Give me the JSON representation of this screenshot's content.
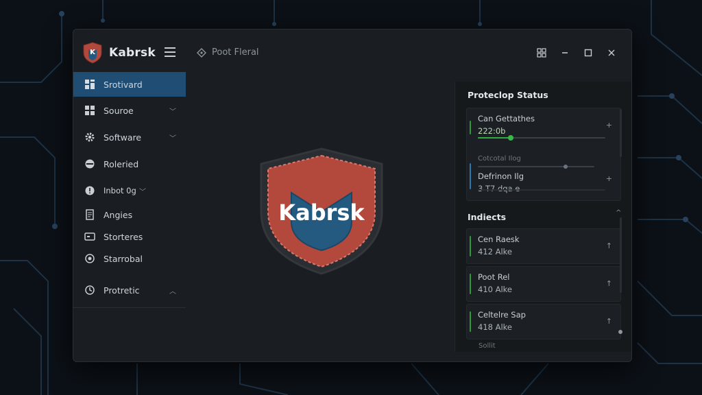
{
  "app": {
    "name": "Kabrsk",
    "breadcrumb": "Poot Fleral"
  },
  "colors": {
    "accent": "#1f4d73",
    "shield_red": "#b3483d",
    "shield_blue": "#245a80",
    "status_green": "#2fae3f",
    "status_blue": "#2e78b0"
  },
  "sidebar": {
    "items": [
      {
        "label": "Srotivard",
        "icon": "dashboard-icon",
        "active": true
      },
      {
        "label": "Souroe",
        "icon": "grid-icon",
        "chevron": "﹀"
      },
      {
        "label": "Software",
        "icon": "gear-icon",
        "chevron": "﹀"
      },
      {
        "label": "Roleried",
        "icon": "shield-icon"
      },
      {
        "label": "Inbot 0g",
        "icon": "info-icon",
        "chevron": "﹀"
      },
      {
        "label": "Angies",
        "icon": "document-icon"
      },
      {
        "label": "Storteres",
        "icon": "monitor-icon"
      },
      {
        "label": "Starrobal",
        "icon": "target-icon"
      },
      {
        "label": "Protretic",
        "icon": "clock-icon",
        "chevron": "︿"
      }
    ]
  },
  "center": {
    "logo_text": "Kabrsk"
  },
  "protection": {
    "title": "Proteclop Status",
    "cards": [
      {
        "title": "Can Gettathes",
        "value": "222:0b",
        "level": 0.26
      },
      {
        "title": "Defrinon Ilg",
        "value": "3 T7 dqa e",
        "header": "Cotcotal Ilog",
        "level": 0.75
      }
    ]
  },
  "incidents": {
    "title": "Indiects",
    "items": [
      {
        "title": "Cen Raesk",
        "value": "412 Alke"
      },
      {
        "title": "Poot Rel",
        "value": "410 Alke"
      },
      {
        "title": "Celtelre Sap",
        "value": "418 Alke"
      }
    ],
    "trailing": "Sollit"
  }
}
